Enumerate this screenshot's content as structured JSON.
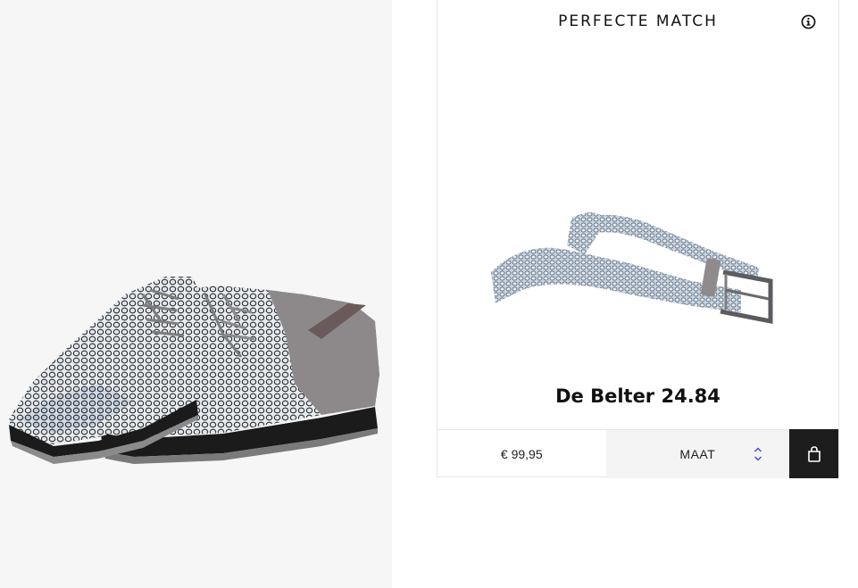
{
  "match_card": {
    "title": "PERFECTE MATCH",
    "product_name": "De Belter 24.84",
    "price": "€ 99,95",
    "size_label": "MAAT"
  },
  "icons": {
    "info": "info-circle-icon",
    "size": "chevron-up-down-icon",
    "cart": "shopping-bag-icon"
  },
  "colors": {
    "left_panel_bg": "#f6f6f6",
    "cart_button_bg": "#1d1d1d",
    "size_select_bg": "#f4f4f4",
    "chevron_accent": "#3b3bd6"
  }
}
